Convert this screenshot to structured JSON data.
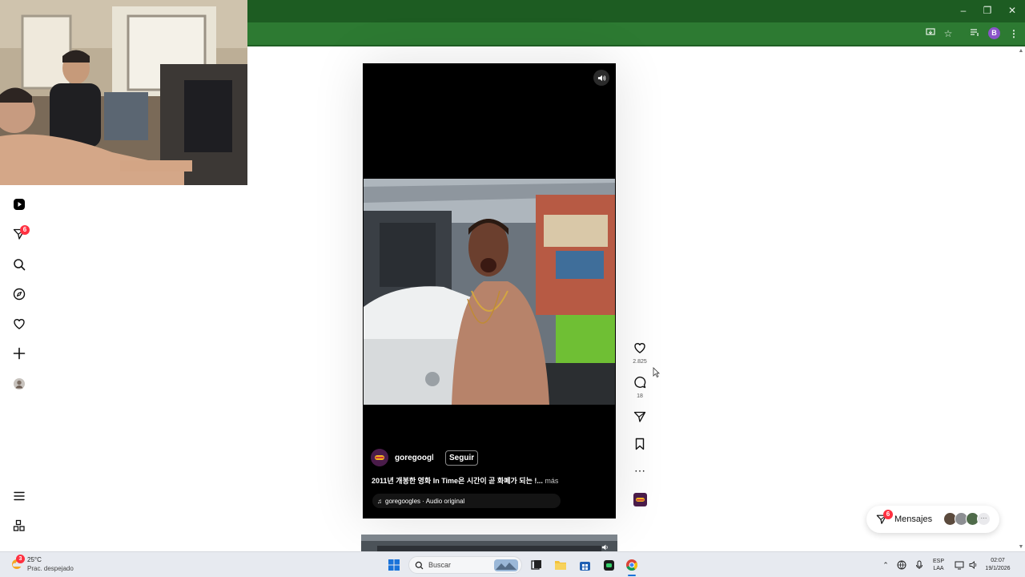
{
  "reel": {
    "author": "goregoogles",
    "follow_label": "Seguir",
    "caption": "2011년 개봉한 영화 In Time은 시간이 곧 화폐가 되는 !...",
    "more_label": "más",
    "audio": "goregoogles · Audio original"
  },
  "actions": {
    "likes": "2.825",
    "comments": "18"
  },
  "nav": {
    "notifications_badge": "6"
  },
  "messages": {
    "label": "Mensajes",
    "badge": "6"
  },
  "taskbar": {
    "weather_temp": "25°C",
    "weather_desc": "Prac. despejado",
    "weather_badge": "3",
    "search_placeholder": "Buscar",
    "lang_top": "ESP",
    "lang_bottom": "LAA",
    "time": "02:07",
    "date": "19/1/2026"
  },
  "browser": {
    "profile_initial": "B"
  },
  "colors": {
    "chrome_title": "#1d5c22",
    "chrome_toolbar": "#2d7a32",
    "badge": "#ff3040"
  }
}
